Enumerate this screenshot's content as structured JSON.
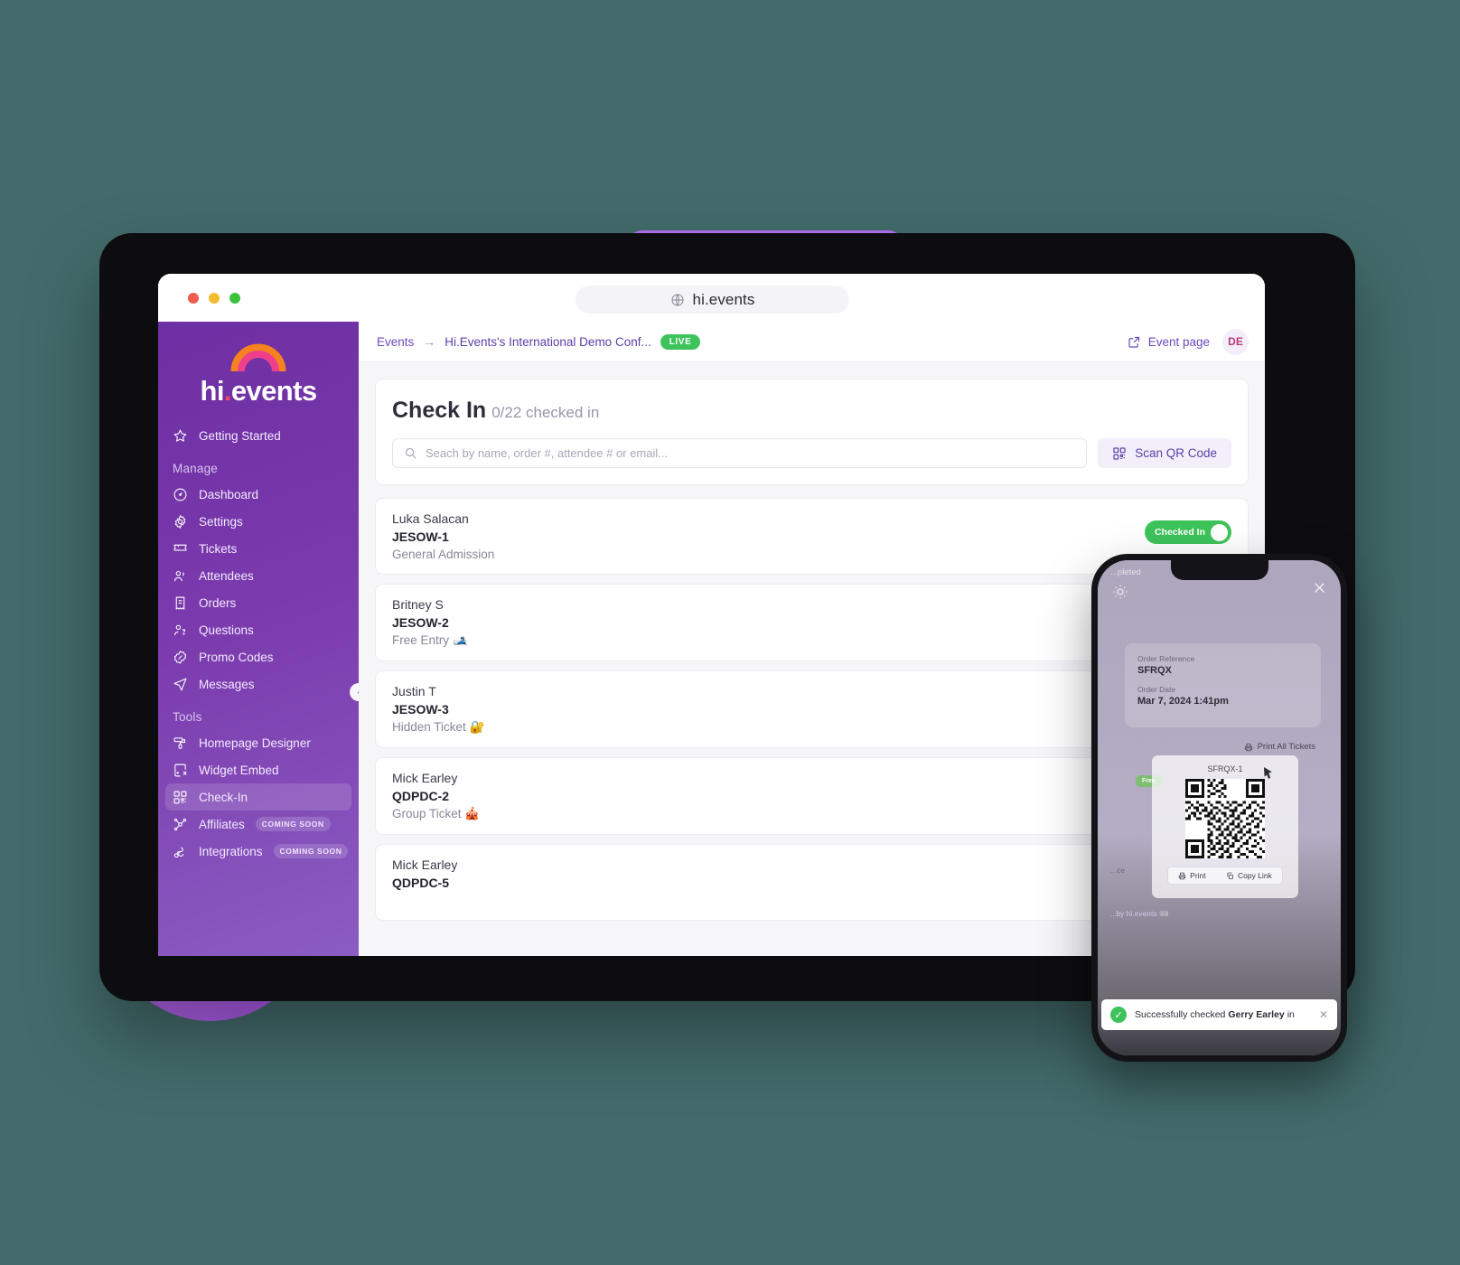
{
  "browser": {
    "url": "hi.events",
    "globe_icon": "globe-icon",
    "traffic_lights": [
      "close",
      "minimize",
      "maximize"
    ]
  },
  "sidebar": {
    "logo_text_main": "hi",
    "logo_text_dot": ".",
    "logo_text_rest": "events",
    "top_items": [
      {
        "label": "Getting Started",
        "icon": "star-icon"
      }
    ],
    "sections": [
      {
        "title": "Manage",
        "items": [
          {
            "label": "Dashboard",
            "icon": "gauge-icon"
          },
          {
            "label": "Settings",
            "icon": "gear-icon"
          },
          {
            "label": "Tickets",
            "icon": "ticket-icon"
          },
          {
            "label": "Attendees",
            "icon": "users-icon"
          },
          {
            "label": "Orders",
            "icon": "receipt-icon"
          },
          {
            "label": "Questions",
            "icon": "question-user-icon"
          },
          {
            "label": "Promo Codes",
            "icon": "percent-badge-icon"
          },
          {
            "label": "Messages",
            "icon": "send-icon"
          }
        ]
      },
      {
        "title": "Tools",
        "items": [
          {
            "label": "Homepage Designer",
            "icon": "paint-roller-icon"
          },
          {
            "label": "Widget Embed",
            "icon": "code-window-icon"
          },
          {
            "label": "Check-In",
            "icon": "qr-icon",
            "active": true
          },
          {
            "label": "Affiliates",
            "icon": "affiliate-icon",
            "badge": "COMING SOON"
          },
          {
            "label": "Integrations",
            "icon": "integrations-icon",
            "badge": "COMING SOON"
          }
        ]
      }
    ],
    "collapse_icon": "chevron-left-icon"
  },
  "topbar": {
    "breadcrumb_root": "Events",
    "breadcrumb_arrow": "→",
    "breadcrumb_current": "Hi.Events's International Demo Conf...",
    "live_badge": "LIVE",
    "event_page_label": "Event page",
    "event_page_icon": "external-link-icon",
    "avatar_initials": "DE"
  },
  "checkin": {
    "title": "Check In",
    "subtitle": "0/22 checked in",
    "search_placeholder": "Seach by name, order #, attendee # or email...",
    "search_value": "",
    "search_icon": "search-icon",
    "scan_button_label": "Scan QR Code",
    "scan_button_icon": "qr-icon",
    "checked_in_label": "Checked In",
    "attendees": [
      {
        "name": "Luka Salacan",
        "ref": "JESOW-1",
        "ticket": "General Admission",
        "checked_in": true
      },
      {
        "name": "Britney S",
        "ref": "JESOW-2",
        "ticket": "Free Entry 🎿",
        "checked_in": false
      },
      {
        "name": "Justin T",
        "ref": "JESOW-3",
        "ticket": "Hidden Ticket 🔐",
        "checked_in": false
      },
      {
        "name": "Mick Earley",
        "ref": "QDPDC-2",
        "ticket": "Group Ticket 🎪",
        "checked_in": false
      },
      {
        "name": "Mick Earley",
        "ref": "QDPDC-5",
        "ticket": "",
        "checked_in": false
      }
    ]
  },
  "phone": {
    "status_text": "...pleted",
    "brightness_icon": "brightness-icon",
    "close_icon": "close-icon",
    "order_reference_label": "Order Reference",
    "order_reference_value": "SFRQX",
    "order_date_label": "Order Date",
    "order_date_value": "Mar 7, 2024 1:41pm",
    "print_all_label": "Print All Tickets",
    "print_all_icon": "printer-icon",
    "ticket_ref": "SFRQX-1",
    "free_chip": "Free",
    "print_label": "Print",
    "print_icon": "printer-icon",
    "copy_link_label": "Copy Link",
    "copy_link_icon": "copy-icon",
    "side_text": "...ce",
    "footer_prefix": "...by ",
    "footer_brand": "hi.events",
    "footer_suffix": " 🎟",
    "toast": {
      "prefix": "Successfully checked ",
      "name": "Gerry Earley",
      "suffix": " in",
      "check_icon": "check-circle-icon",
      "close_icon": "close-icon"
    }
  },
  "colors": {
    "brand_purple": "#7b3aad",
    "accent_purple": "#6b4bbd",
    "green": "#3dc35a",
    "pink": "#f4436c"
  }
}
